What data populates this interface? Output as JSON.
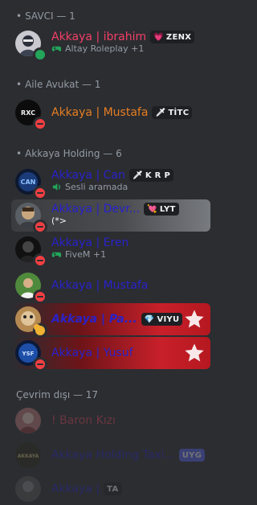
{
  "groups": {
    "savci": "SAVCI — 1",
    "aile": "Aile Avukat — 1",
    "holding": "Akkaya Holding — 6",
    "offline": "Çevrim dışı — 17"
  },
  "members": {
    "ibrahim": {
      "name": "Akkaya | ibrahim",
      "tag": "ZENX",
      "activity": "Altay Roleplay +1",
      "color": "#f23f67"
    },
    "mustafa_avukat": {
      "name": "Akkaya | Mustafa",
      "tag": "TİTC",
      "color": "#e67e22"
    },
    "can": {
      "name": "Akkaya | Can",
      "tag": "K R P",
      "activity": "Sesli aramada",
      "color": "#2a22c9"
    },
    "devri": {
      "name": "Akkaya | Devr...",
      "tag": "LYT",
      "activity": "(*>",
      "color": "#2a22c9"
    },
    "eren": {
      "name": "Akkaya | Eren",
      "activity": "FiveM +1",
      "color": "#2a22c9"
    },
    "mustafa": {
      "name": "Akkaya | Mustafa",
      "color": "#2a22c9"
    },
    "pa": {
      "name": "Akkaya | Pa...",
      "tag": "VIYU",
      "color": "#2a22c9"
    },
    "yusuf": {
      "name": "Akkaya | Yusuf",
      "color": "#2a22c9"
    },
    "baron": {
      "name": "! Baron Kızı",
      "color": "#e0455a"
    },
    "holding_taxi": {
      "name": "Akkaya Holding Taxi...",
      "tag": "UYG",
      "color": "#2a22c9"
    },
    "last": {
      "name": "Akkaya |",
      "tag": "TA",
      "color": "#2a22c9"
    }
  },
  "icons": {
    "game": "gamepad-icon",
    "voice": "voice-call-icon"
  }
}
